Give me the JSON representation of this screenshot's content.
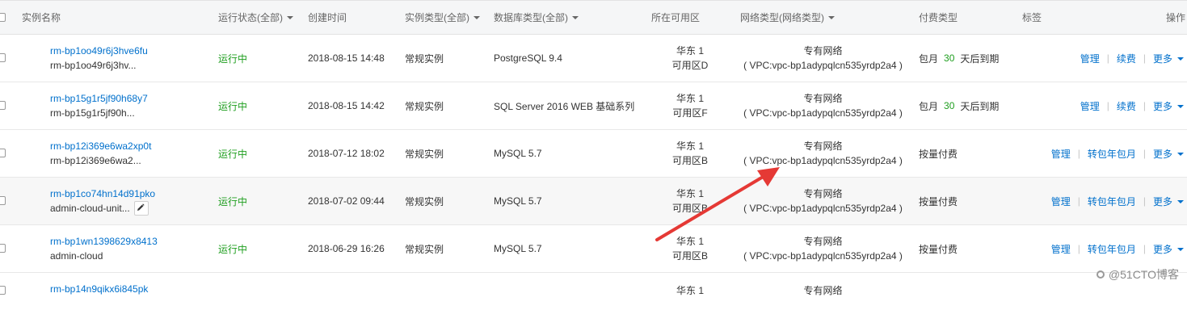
{
  "header": {
    "instance_name": "实例名称",
    "status": "运行状态(全部)",
    "created": "创建时间",
    "instance_type": "实例类型(全部)",
    "db_type": "数据库类型(全部)",
    "zone": "所在可用区",
    "network_type": "网络类型(网络类型)",
    "billing": "付费类型",
    "tags": "标签",
    "actions": "操作"
  },
  "rows": [
    {
      "id": "rm-bp1oo49r6j3hve6fu",
      "name": "rm-bp1oo49r6j3hv...",
      "status": "运行中",
      "created": "2018-08-15 14:48",
      "instance_type": "常规实例",
      "db_type": "PostgreSQL 9.4",
      "zone_line1": "华东 1",
      "zone_line2": "可用区D",
      "network_line1": "专有网络",
      "network_line2": "( VPC:vpc-bp1adypqlcn535yrdp2a4 )",
      "billing_prefix": "包月",
      "billing_days": "30",
      "billing_suffix": "天后到期",
      "action1": "管理",
      "action2": "续费",
      "action3": "更多"
    },
    {
      "id": "rm-bp15g1r5jf90h68y7",
      "name": "rm-bp15g1r5jf90h...",
      "status": "运行中",
      "created": "2018-08-15 14:42",
      "instance_type": "常规实例",
      "db_type": "SQL Server 2016 WEB 基础系列",
      "zone_line1": "华东 1",
      "zone_line2": "可用区F",
      "network_line1": "专有网络",
      "network_line2": "( VPC:vpc-bp1adypqlcn535yrdp2a4 )",
      "billing_prefix": "包月",
      "billing_days": "30",
      "billing_suffix": "天后到期",
      "action1": "管理",
      "action2": "续费",
      "action3": "更多"
    },
    {
      "id": "rm-bp12i369e6wa2xp0t",
      "name": "rm-bp12i369e6wa2...",
      "status": "运行中",
      "created": "2018-07-12 18:02",
      "instance_type": "常规实例",
      "db_type": "MySQL 5.7",
      "zone_line1": "华东 1",
      "zone_line2": "可用区B",
      "network_line1": "专有网络",
      "network_line2": "( VPC:vpc-bp1adypqlcn535yrdp2a4 )",
      "billing": "按量付费",
      "action1": "管理",
      "action2": "转包年包月",
      "action3": "更多"
    },
    {
      "id": "rm-bp1co74hn14d91pko",
      "name": "admin-cloud-unit...",
      "status": "运行中",
      "created": "2018-07-02 09:44",
      "instance_type": "常规实例",
      "db_type": "MySQL 5.7",
      "zone_line1": "华东 1",
      "zone_line2": "可用区B",
      "network_line1": "专有网络",
      "network_line2": "( VPC:vpc-bp1adypqlcn535yrdp2a4 )",
      "billing": "按量付费",
      "action1": "管理",
      "action2": "转包年包月",
      "action3": "更多"
    },
    {
      "id": "rm-bp1wn1398629x8413",
      "name": "admin-cloud",
      "status": "运行中",
      "created": "2018-06-29 16:26",
      "instance_type": "常规实例",
      "db_type": "MySQL 5.7",
      "zone_line1": "华东 1",
      "zone_line2": "可用区B",
      "network_line1": "专有网络",
      "network_line2": "( VPC:vpc-bp1adypqlcn535yrdp2a4 )",
      "billing": "按量付费",
      "action1": "管理",
      "action2": "转包年包月",
      "action3": "更多"
    },
    {
      "id": "rm-bp14n9qikx6i845pk",
      "zone_line1": "华东 1",
      "network_line1": "专有网络"
    }
  ],
  "watermark": "@51CTO博客",
  "colors": {
    "link": "#0070cc",
    "running": "#1e9e1e",
    "arrow": "#e53935",
    "header_bg": "#f5f6f7"
  },
  "icons": [
    "checkbox-icon",
    "caret-down-icon",
    "edit-icon",
    "red-arrow-annotation"
  ]
}
